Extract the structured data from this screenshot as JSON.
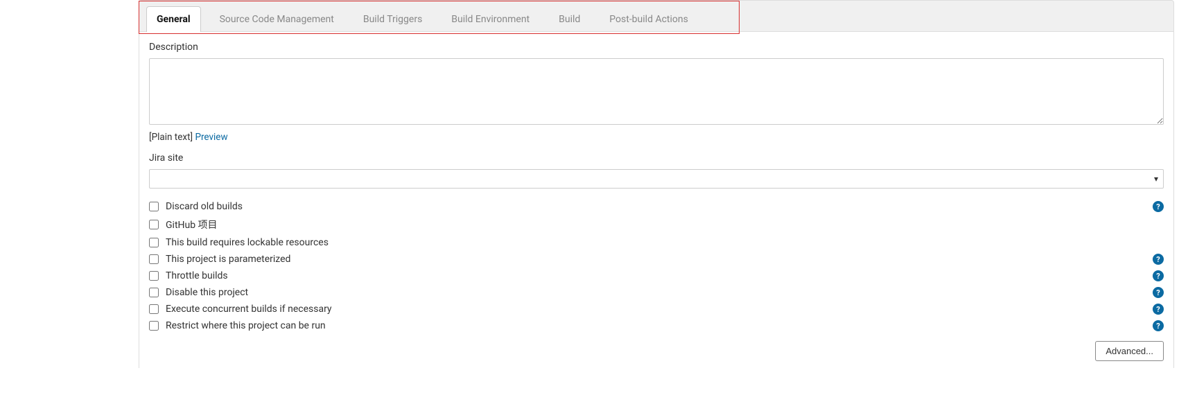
{
  "tabs": [
    {
      "label": "General",
      "active": true
    },
    {
      "label": "Source Code Management",
      "active": false
    },
    {
      "label": "Build Triggers",
      "active": false
    },
    {
      "label": "Build Environment",
      "active": false
    },
    {
      "label": "Build",
      "active": false
    },
    {
      "label": "Post-build Actions",
      "active": false
    }
  ],
  "description": {
    "label": "Description",
    "value": "",
    "plain_text": "[Plain text]",
    "preview": "Preview"
  },
  "jira": {
    "label": "Jira site",
    "selected": ""
  },
  "checkboxes": [
    {
      "label": "Discard old builds",
      "help": true
    },
    {
      "label": "GitHub 项目",
      "help": false
    },
    {
      "label": "This build requires lockable resources",
      "help": false
    },
    {
      "label": "This project is parameterized",
      "help": true
    },
    {
      "label": "Throttle builds",
      "help": true
    },
    {
      "label": "Disable this project",
      "help": true
    },
    {
      "label": "Execute concurrent builds if necessary",
      "help": true
    },
    {
      "label": "Restrict where this project can be run",
      "help": true
    }
  ],
  "advanced_button": "Advanced..."
}
